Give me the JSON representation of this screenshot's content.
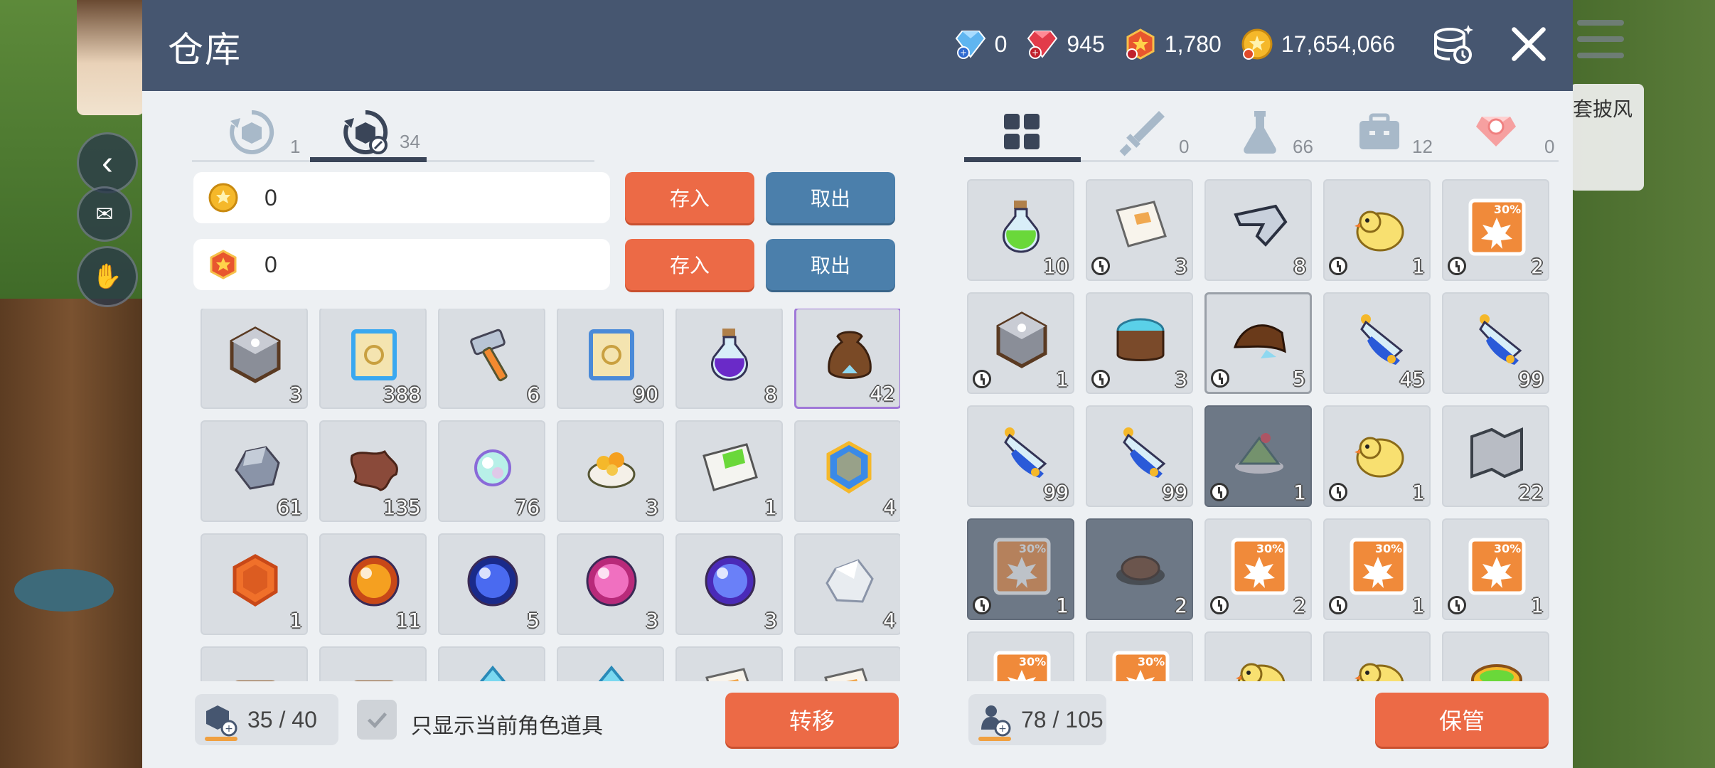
{
  "header": {
    "title": "仓库",
    "currencies": [
      {
        "icon": "blue-diamond-icon",
        "value": "0"
      },
      {
        "icon": "red-gem-icon",
        "value": "945"
      },
      {
        "icon": "maple-point-icon",
        "value": "1,780"
      },
      {
        "icon": "meso-coin-icon",
        "value": "17,654,066"
      }
    ]
  },
  "left": {
    "tabs": [
      {
        "icon": "shared-storage-icon",
        "count": "1"
      },
      {
        "icon": "character-storage-icon",
        "count": "34"
      }
    ],
    "meso_field": {
      "icon": "meso-coin-icon",
      "value": "0"
    },
    "point_field": {
      "icon": "maple-point-icon",
      "value": "0"
    },
    "deposit_label": "存入",
    "withdraw_label": "取出",
    "items": [
      {
        "icon": "cube-icon",
        "count": "3"
      },
      {
        "icon": "scroll-blue-icon",
        "count": "388"
      },
      {
        "icon": "hammer-icon",
        "count": "6"
      },
      {
        "icon": "scroll-gold-icon",
        "count": "90"
      },
      {
        "icon": "purple-potion-icon",
        "count": "8"
      },
      {
        "icon": "brown-bag-icon",
        "count": "42"
      },
      {
        "icon": "ore-icon",
        "count": "61"
      },
      {
        "icon": "leather-icon",
        "count": "135"
      },
      {
        "icon": "rainbow-orb-icon",
        "count": "76"
      },
      {
        "icon": "gold-nugget-icon",
        "count": "3"
      },
      {
        "icon": "green-scroll-icon",
        "count": "1"
      },
      {
        "icon": "blue-gem-icon",
        "count": "4"
      },
      {
        "icon": "orange-gem-icon",
        "count": "1"
      },
      {
        "icon": "orange-orb-icon",
        "count": "11"
      },
      {
        "icon": "blue-orb-icon",
        "count": "5"
      },
      {
        "icon": "pink-orb-icon",
        "count": "3"
      },
      {
        "icon": "violet-orb-icon",
        "count": "3"
      },
      {
        "icon": "white-crystal-icon",
        "count": "4"
      },
      {
        "icon": "scroll-roll-icon",
        "count": ""
      },
      {
        "icon": "scroll-roll-icon",
        "count": ""
      },
      {
        "icon": "diamond-icon",
        "count": ""
      },
      {
        "icon": "diamond-icon",
        "count": ""
      },
      {
        "icon": "paper-icon",
        "count": ""
      },
      {
        "icon": "paper-icon",
        "count": ""
      }
    ],
    "capacity": "35 / 40",
    "checkbox_label": "只显示当前角色道具",
    "transfer_label": "转移"
  },
  "right": {
    "tabs": [
      {
        "icon": "all-grid-icon",
        "count": ""
      },
      {
        "icon": "sword-icon",
        "count": "0"
      },
      {
        "icon": "flask-icon",
        "count": "66"
      },
      {
        "icon": "briefcase-icon",
        "count": "12"
      },
      {
        "icon": "cash-icon",
        "count": "0"
      }
    ],
    "items": [
      {
        "icon": "green-potion-icon",
        "count": "10",
        "timed": false
      },
      {
        "icon": "paper-icon",
        "count": "3",
        "timed": true
      },
      {
        "icon": "blade-icon",
        "count": "8",
        "timed": false
      },
      {
        "icon": "chick-icon",
        "count": "1",
        "timed": true
      },
      {
        "icon": "maple-coupon-icon",
        "count": "2",
        "timed": true
      },
      {
        "icon": "cube-icon",
        "count": "1",
        "timed": true
      },
      {
        "icon": "stump-icon",
        "count": "3",
        "timed": true
      },
      {
        "icon": "horn-icon",
        "count": "5",
        "timed": true
      },
      {
        "icon": "blue-potion-icon",
        "count": "45",
        "timed": false
      },
      {
        "icon": "blue-potion-icon",
        "count": "99",
        "timed": false
      },
      {
        "icon": "blue-potion-icon",
        "count": "99",
        "timed": false
      },
      {
        "icon": "blue-potion-icon",
        "count": "99",
        "timed": false
      },
      {
        "icon": "cake-icon",
        "count": "1",
        "timed": true
      },
      {
        "icon": "chick-icon",
        "count": "1",
        "timed": true
      },
      {
        "icon": "map-icon",
        "count": "22",
        "timed": false
      },
      {
        "icon": "maple-coupon-icon",
        "count": "1",
        "timed": true
      },
      {
        "icon": "chocolate-icon",
        "count": "2",
        "timed": false
      },
      {
        "icon": "maple-coupon-icon",
        "count": "2",
        "timed": true
      },
      {
        "icon": "maple-coupon-icon",
        "count": "1",
        "timed": true
      },
      {
        "icon": "maple-coupon-icon",
        "count": "1",
        "timed": true
      },
      {
        "icon": "maple-coupon-icon",
        "count": "",
        "timed": false
      },
      {
        "icon": "maple-coupon-icon",
        "count": "",
        "timed": false
      },
      {
        "icon": "chick-icon",
        "count": "",
        "timed": false
      },
      {
        "icon": "chick-icon",
        "count": "",
        "timed": false
      },
      {
        "icon": "bowl-icon",
        "count": "",
        "timed": false
      }
    ],
    "capacity": "78 / 105",
    "store_label": "保管"
  },
  "background": {
    "side_label": "套披风"
  },
  "colors": {
    "header": "#465670",
    "orange_button": "#ec6a46",
    "blue_button": "#4b7fab",
    "panel": "#edf0f3",
    "slot": "#d9dde2"
  }
}
